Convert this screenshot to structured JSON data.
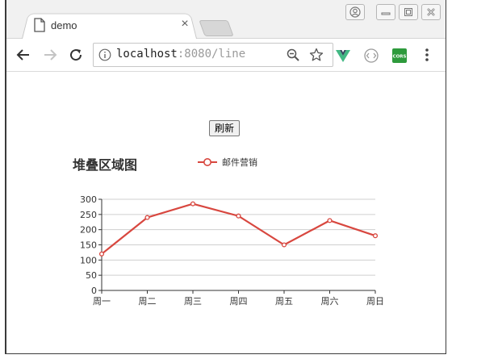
{
  "browser": {
    "tab_title": "demo",
    "url_host": "localhost",
    "url_rest": ":8080/line"
  },
  "page": {
    "refresh_label": "刷新",
    "chart_title": "堆叠区域图"
  },
  "colors": {
    "series": "#d8473f",
    "vue_green": "#41b883",
    "cors_green": "#2e9a3c"
  },
  "chart_data": {
    "type": "line",
    "title": "堆叠区域图",
    "categories": [
      "周一",
      "周二",
      "周三",
      "周四",
      "周五",
      "周六",
      "周日"
    ],
    "series": [
      {
        "name": "邮件营销",
        "values": [
          120,
          240,
          285,
          245,
          150,
          230,
          180
        ]
      }
    ],
    "ylim": [
      0,
      300
    ],
    "yticks": [
      0,
      50,
      100,
      150,
      200,
      250,
      300
    ],
    "grid": true,
    "legend_position": "top"
  }
}
